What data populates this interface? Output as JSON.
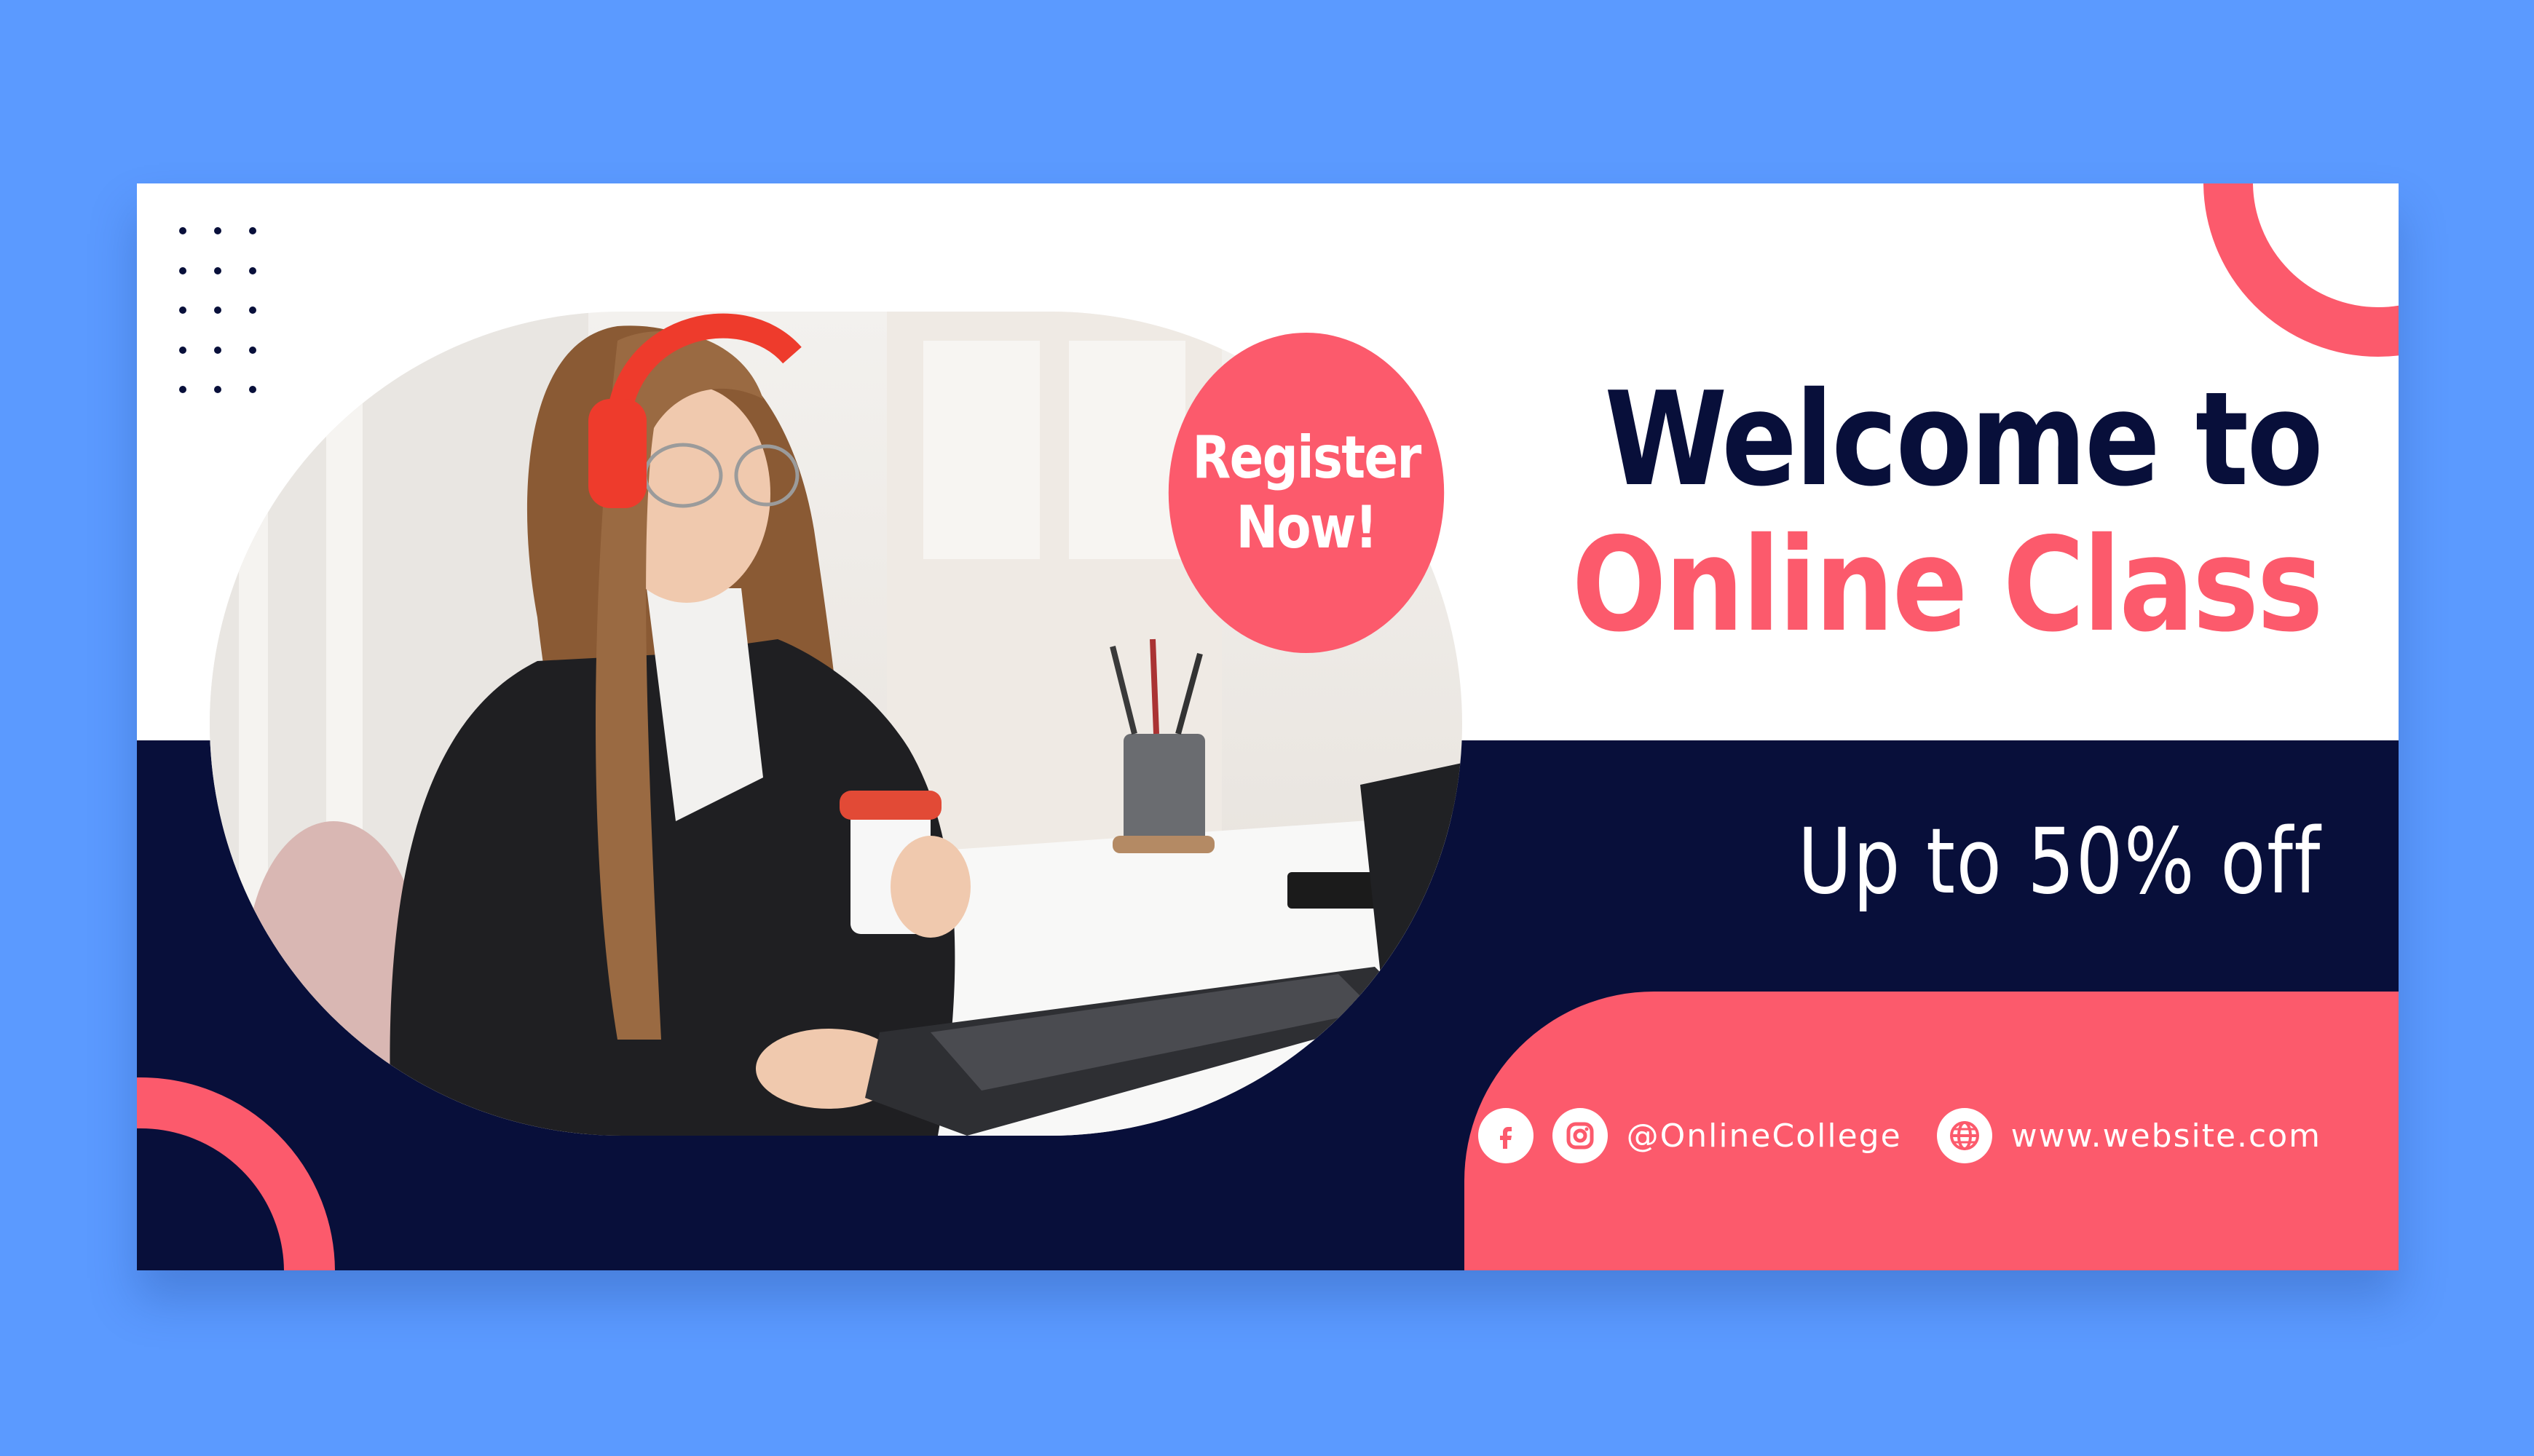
{
  "badge": {
    "line1": "Register",
    "line2": "Now!"
  },
  "headline": {
    "line1": "Welcome to",
    "line2": "Online Class"
  },
  "offer": "Up to 50% off",
  "contact": {
    "social_handle": "@OnlineCollege",
    "website": "www.website.com"
  },
  "icons": [
    "facebook-icon",
    "instagram-icon",
    "globe-icon"
  ],
  "colors": {
    "background": "#5b9aff",
    "navy": "#080f3a",
    "pink": "#fc5a6c",
    "white": "#ffffff"
  }
}
